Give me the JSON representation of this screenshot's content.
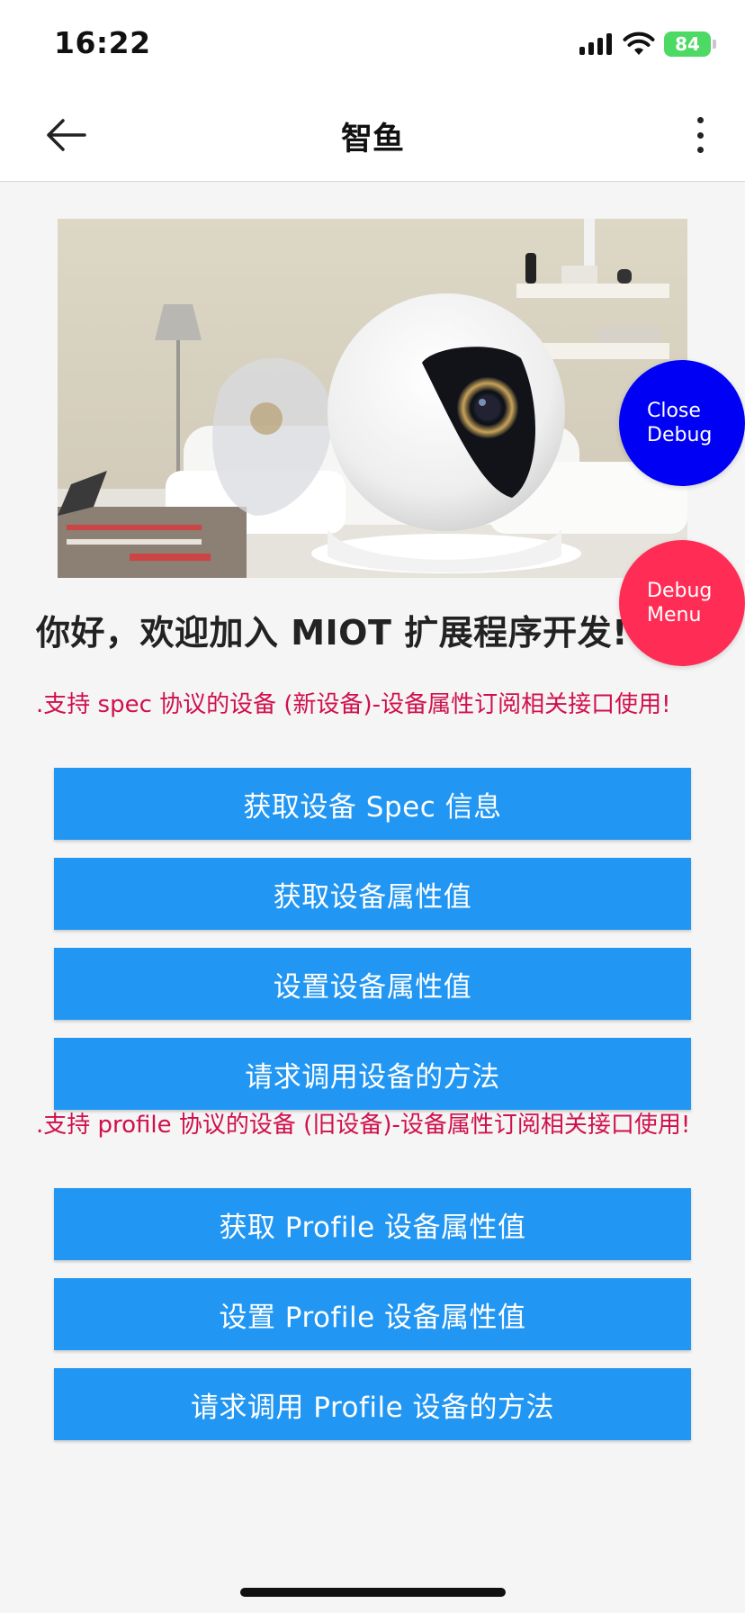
{
  "status_bar": {
    "time": "16:22",
    "battery": "84"
  },
  "nav": {
    "title": "智鱼"
  },
  "debug": {
    "close_line1": "Close",
    "close_line2": "Debug",
    "menu_line1": "Debug",
    "menu_line2": "Menu"
  },
  "main": {
    "welcome": "你好，欢迎加入 MIOT 扩展程序开发!",
    "spec_note": ".支持 spec 协议的设备 (新设备)-设备属性订阅相关接口使用!",
    "spec_buttons": [
      "获取设备 Spec 信息",
      "获取设备属性值",
      "设置设备属性值",
      "请求调用设备的方法"
    ],
    "profile_note": ".支持 profile 协议的设备 (旧设备)-设备属性订阅相关接口使用!",
    "profile_buttons": [
      "获取 Profile 设备属性值",
      "设置 Profile 设备属性值",
      "请求调用 Profile 设备的方法"
    ]
  },
  "colors": {
    "button": "#2196f3",
    "note_text": "#d0104c",
    "close_debug": "#0000f5",
    "debug_menu": "#ff2d55"
  },
  "icons": [
    "signal-icon",
    "wifi-icon",
    "battery-icon",
    "back-arrow-icon",
    "more-vertical-icon"
  ]
}
